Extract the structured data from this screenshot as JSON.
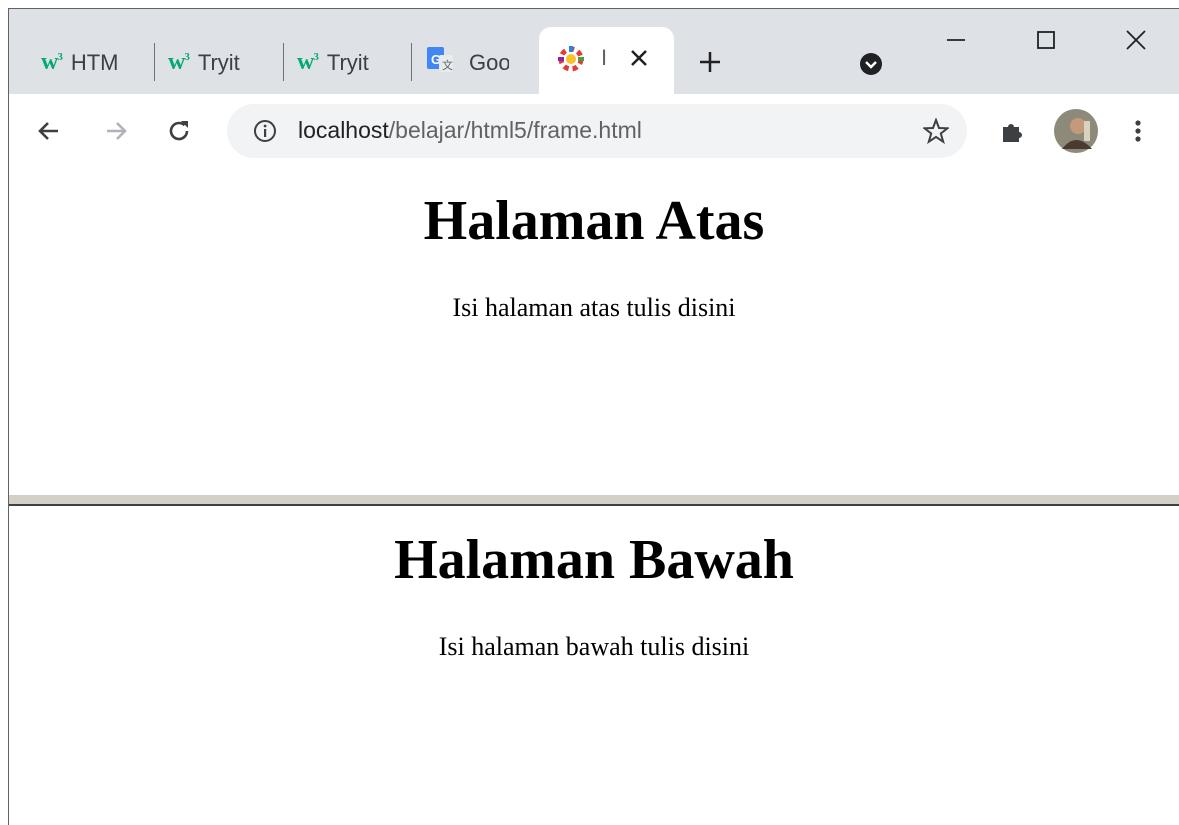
{
  "browser": {
    "tabs": [
      {
        "label": "HTM",
        "icon": "w3schools-icon"
      },
      {
        "label": "Tryit",
        "icon": "w3schools-icon"
      },
      {
        "label": "Tryit",
        "icon": "w3schools-icon"
      },
      {
        "label": "Goo",
        "icon": "google-translate-icon"
      },
      {
        "label": "I",
        "icon": "gear-color-icon",
        "active": true
      }
    ],
    "w3_logo": "w",
    "w3_sup": "3",
    "url_host": "localhost",
    "url_path": "/belajar/html5/frame.html"
  },
  "frames": {
    "top": {
      "heading": "Halaman Atas",
      "text": "Isi halaman atas tulis disini"
    },
    "bottom": {
      "heading": "Halaman Bawah",
      "text": "Isi halaman bawah tulis disini"
    }
  },
  "colors": {
    "accent": "#04aa6d",
    "tabstrip": "#dee1e6",
    "omnibox": "#f1f3f4",
    "splitter": "#d4d0c8"
  }
}
